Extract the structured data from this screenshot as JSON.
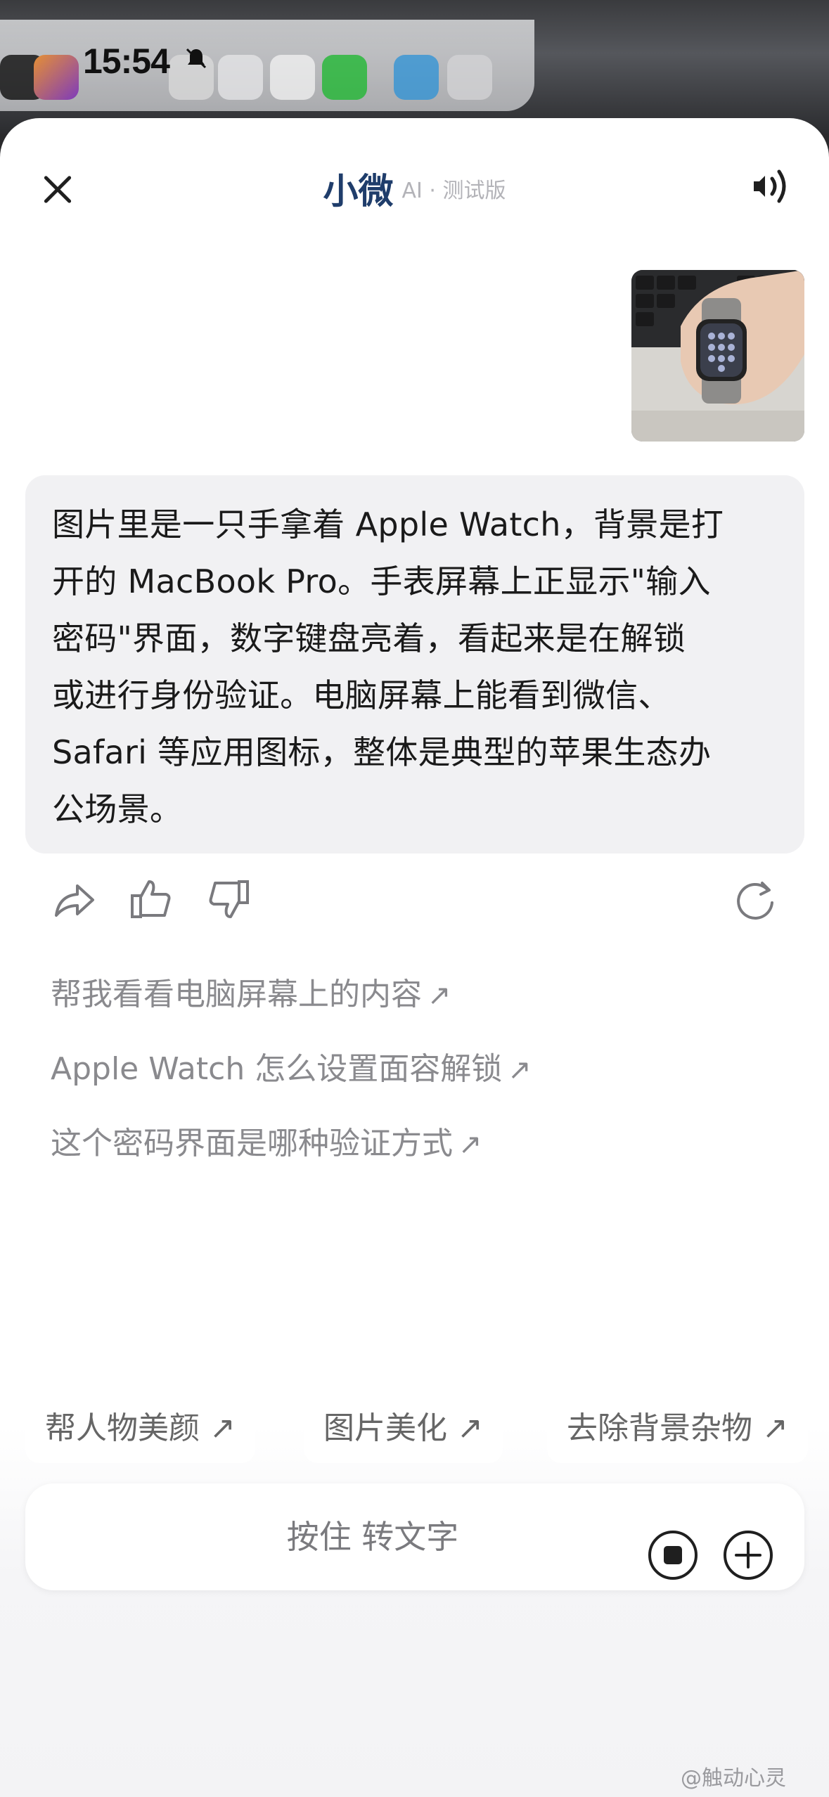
{
  "status_bar": {
    "time": "15:54",
    "silent_icon": "bell-slash-icon"
  },
  "header": {
    "title": "小微",
    "subtitle": "AI · 测试版",
    "close_icon": "close-icon",
    "speaker_icon": "speaker-icon"
  },
  "conversation": {
    "user_image": "photo-of-apple-watch-on-hand",
    "ai_reply": "图片里是一只手拿着 Apple Watch，背景是打开的 MacBook Pro。手表屏幕上正显示\"输入密码\"界面，数字键盘亮着，看起来是在解锁或进行身份验证。电脑屏幕上能看到微信、Safari 等应用图标，整体是典型的苹果生态办公场景。",
    "reply_lines": [
      "图片里是一只手拿着 Apple Watch，背景是打",
      "开的 MacBook Pro。手表屏幕上正显示\"输入",
      "密码\"界面，数字键盘亮着，看起来是在解锁",
      "或进行身份验证。电脑屏幕上能看到微信、",
      "Safari 等应用图标，整体是典型的苹果生态办",
      "公场景。"
    ],
    "actions": [
      "share-icon",
      "thumbs-up-icon",
      "thumbs-down-icon",
      "regenerate-icon"
    ]
  },
  "suggestions": [
    {
      "label": "帮我看看电脑屏幕上的内容",
      "arrow": "↗"
    },
    {
      "label": "Apple Watch 怎么设置面容解锁",
      "arrow": "↗"
    },
    {
      "label": "这个密码界面是哪种验证方式",
      "arrow": "↗"
    }
  ],
  "chips": [
    {
      "label": "帮人物美颜 ↗"
    },
    {
      "label": "图片美化 ↗"
    },
    {
      "label": "去除背景杂物 ↗"
    }
  ],
  "input_bar": {
    "label": "按住 转文字",
    "stop_icon": "stop-icon",
    "add_icon": "plus-icon"
  },
  "watermark": "@触动心灵",
  "colors": {
    "title": "#1f3d6b",
    "bubble_bg": "#f1f1f3",
    "suggestion_text": "#8a8a8e"
  }
}
